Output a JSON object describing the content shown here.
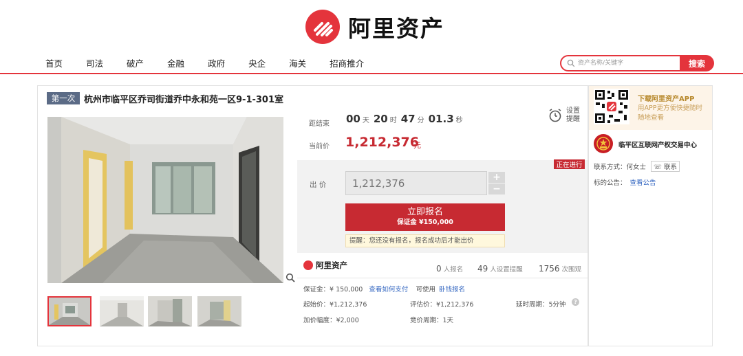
{
  "brand": {
    "name": "阿里资产",
    "accent": "#e4343c",
    "price_red": "#c72a32",
    "link_blue": "#3467c1"
  },
  "nav": [
    "首页",
    "司法",
    "破产",
    "金融",
    "政府",
    "央企",
    "海关",
    "招商推介"
  ],
  "search": {
    "placeholder": "资产名称/关键字",
    "button": "搜索"
  },
  "lot": {
    "round": "第一次",
    "title": "杭州市临平区乔司街道乔中永和苑一区9-1-301室"
  },
  "countdown": {
    "label": "距结束",
    "parts": [
      {
        "num": "00",
        "unit": "天"
      },
      {
        "num": "20",
        "unit": "时"
      },
      {
        "num": "47",
        "unit": "分"
      },
      {
        "num": "01.3",
        "unit": "秒"
      }
    ]
  },
  "reminder": {
    "line1": "设置",
    "line2": "提醒"
  },
  "price": {
    "label": "当前价",
    "value": "1,212,376",
    "unit": "元"
  },
  "status": "正在进行",
  "bid": {
    "label": "出 价",
    "value": "1,212,376",
    "plus": "+",
    "minus": "−"
  },
  "register": {
    "label": "立即报名",
    "deposit": "保证金 ¥150,000"
  },
  "tip": "提醒：您还没有报名，报名成功后才能出价",
  "stats": [
    {
      "n": "0",
      "l": "人报名"
    },
    {
      "n": "49",
      "l": "人设置提醒"
    },
    {
      "n": "1756",
      "l": "次围观"
    }
  ],
  "details": {
    "deposit_label": "保证金：¥ 150,000",
    "how_to_pay": "查看如何支付",
    "usable": "可使用",
    "credit": "卧钱报名",
    "start_price": "起始价：¥1,212,376",
    "appraisal": "评估价：¥1,212,376",
    "delay": "延时周期：5分钟",
    "increment": "加价幅度：¥2,000",
    "cycle": "竞价周期：1天"
  },
  "sidebar": {
    "app_title": "下载阿里资产APP",
    "app_desc": "用APP更方便快捷随时随地查看",
    "org": "临平区互联网产权交易中心",
    "contact_label": "联系方式：何女士",
    "contact_btn": "联系",
    "notice_label": "标的公告：",
    "notice_link": "查看公告"
  }
}
